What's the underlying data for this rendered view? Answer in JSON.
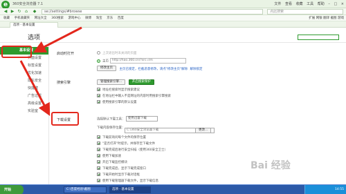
{
  "browser": {
    "title": "360安全浏览器 7.1",
    "url": "se://settings/#browse",
    "search_placeholder": "点此搜索",
    "window_controls": [
      "文件",
      "查看",
      "收藏",
      "工具",
      "帮助"
    ],
    "tab_label": "选项 - 基本设置"
  },
  "bookmarks": {
    "items": [
      "收藏",
      "手机收藏夹",
      "网址大全",
      "360搜索",
      "游戏中心",
      "微博",
      "淘宝",
      "京东",
      "百度"
    ],
    "right": [
      "扩展",
      "网银",
      "翻译",
      "截图",
      "游戏"
    ]
  },
  "page": {
    "title": "选项",
    "sidebar": [
      {
        "label": "基本设置",
        "active": true
      },
      {
        "label": "界面设置",
        "active": false
      },
      {
        "label": "标签设置",
        "active": false
      },
      {
        "label": "优化加速",
        "active": false
      },
      {
        "label": "隐私安全",
        "active": false
      },
      {
        "label": "快捷键",
        "active": false
      },
      {
        "label": "广告过滤",
        "active": false
      },
      {
        "label": "高级设置",
        "active": false
      },
      {
        "label": "实验室",
        "active": false
      }
    ],
    "startup": {
      "label": "启动时打开",
      "options": [
        {
          "text": "上次退出时未关闭的页面",
          "selected": false
        },
        {
          "text": "主页",
          "selected": true
        }
      ],
      "homepage_url": "http://hao.360.cn/?src=lm",
      "modify_button": "修改主页",
      "links": "主页已锁定，拦截恶意修改，请点\"修改主页\"解除",
      "unlock_link": "解除锁定"
    },
    "search": {
      "label": "搜索引擎",
      "manage_button": "管理搜索引擎...",
      "protect_button": "开启搜索保护",
      "checks": [
        {
          "text": "地址栏搜索时显示搜索建议",
          "checked": true
        },
        {
          "text": "在地址栏中输入不是网址的内容时用搜索引擎搜索",
          "checked": true
        },
        {
          "text": "使用搜索引擎的默认设置",
          "checked": true
        }
      ]
    },
    "download": {
      "label": "下载设置",
      "tool_prefix": "选择默认下载工具：",
      "tool_value": "使用迅雷下载",
      "dir_label": "下载内容保存位置：",
      "dir_value": "C:\\360安全浏览器下载",
      "browse_button": "更改...",
      "checks": [
        {
          "text": "下载前询问每个文件的保存位置",
          "checked": true
        },
        {
          "text": "\"是否打开\"时提示，并保存至下载文件",
          "checked": true
        },
        {
          "text": "下载完成后进行安全扫描（使用360安全卫士）",
          "checked": true
        },
        {
          "text": "使用下载加速",
          "checked": true
        },
        {
          "text": "开启下载监控模块",
          "checked": true
        },
        {
          "text": "下载完成后，显示下载完成窗口",
          "checked": true
        },
        {
          "text": "下载开始时显示下载对话框",
          "checked": true
        },
        {
          "text": "使用下载管理器下载文件，显示下载信息",
          "checked": true
        }
      ]
    }
  },
  "taskbar": {
    "start": "开始",
    "tasks": [
      {
        "label": "C:\\百度经验\\截图",
        "active": false
      },
      {
        "label": "选项 - 基本设置",
        "active": true
      }
    ],
    "clock": "14:55"
  },
  "watermark": "Bai 经验"
}
